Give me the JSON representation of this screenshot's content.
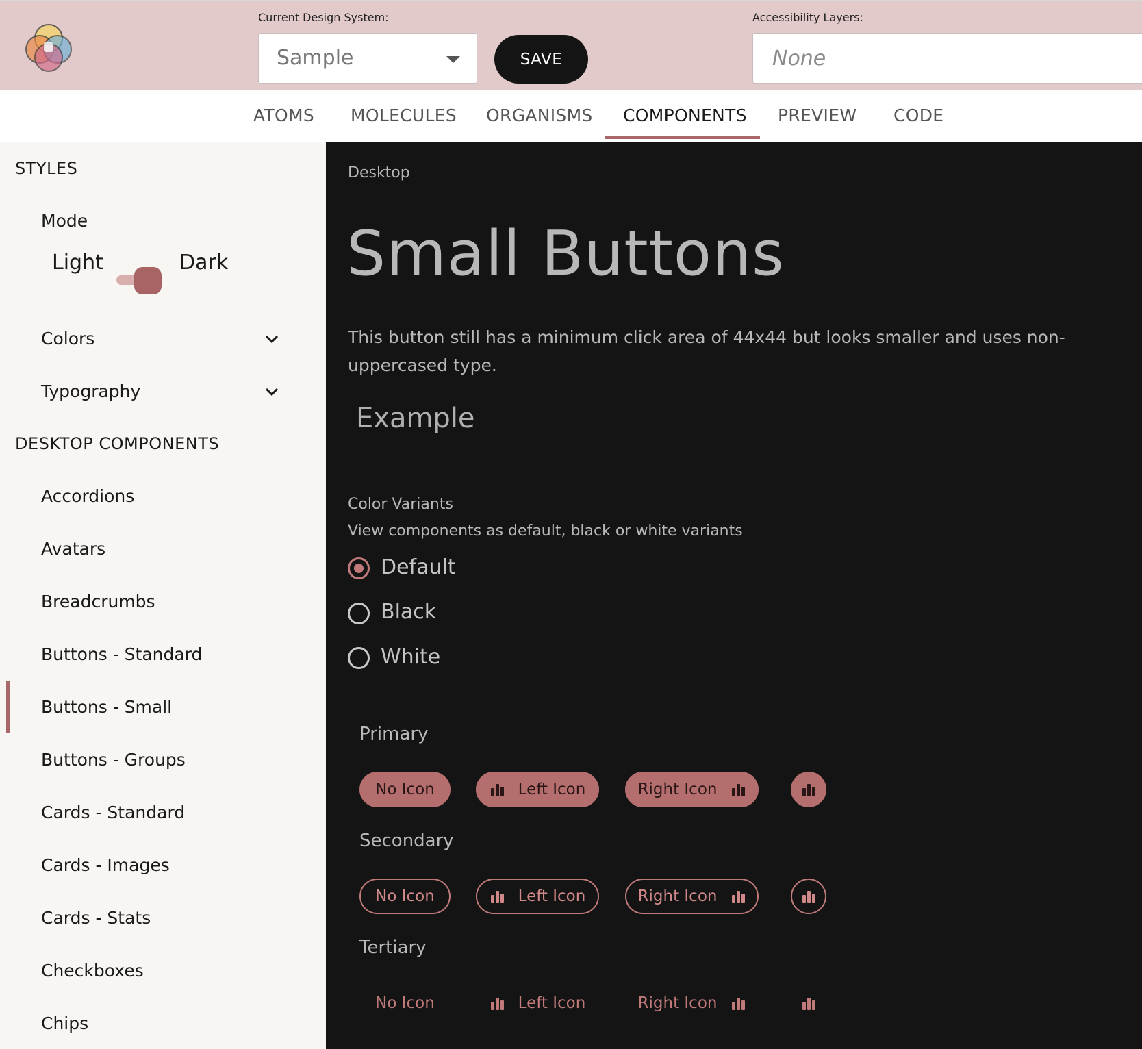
{
  "header": {
    "design_system_label": "Current Design System:",
    "design_system_value": "Sample",
    "save_label": "SAVE",
    "accessibility_label": "Accessibility Layers:",
    "accessibility_placeholder": "None"
  },
  "tabs": [
    {
      "label": "ATOMS",
      "active": false
    },
    {
      "label": "MOLECULES",
      "active": false
    },
    {
      "label": "ORGANISMS",
      "active": false
    },
    {
      "label": "COMPONENTS",
      "active": true
    },
    {
      "label": "PREVIEW",
      "active": false
    },
    {
      "label": "CODE",
      "active": false
    }
  ],
  "sidebar": {
    "styles_heading": "STYLES",
    "mode_label": "Mode",
    "mode_light": "Light",
    "mode_dark": "Dark",
    "mode_value": "Dark",
    "colors_label": "Colors",
    "typography_label": "Typography",
    "components_heading": "DESKTOP COMPONENTS",
    "items": [
      {
        "label": "Accordions"
      },
      {
        "label": "Avatars"
      },
      {
        "label": "Breadcrumbs"
      },
      {
        "label": "Buttons - Standard"
      },
      {
        "label": "Buttons - Small",
        "active": true
      },
      {
        "label": "Buttons - Groups"
      },
      {
        "label": "Cards - Standard"
      },
      {
        "label": "Cards - Images"
      },
      {
        "label": "Cards - Stats"
      },
      {
        "label": "Checkboxes"
      },
      {
        "label": "Chips"
      }
    ]
  },
  "main": {
    "breadcrumb": "Desktop",
    "title": "Small Buttons",
    "description": "This button still has a minimum click area of 44x44 but looks smaller and uses non-uppercased type.",
    "example_heading": "Example",
    "color_variants_title": "Color Variants",
    "color_variants_subtitle": "View components as default, black or white variants",
    "variants": [
      {
        "label": "Default",
        "checked": true
      },
      {
        "label": "Black",
        "checked": false
      },
      {
        "label": "White",
        "checked": false
      }
    ],
    "groups": [
      {
        "label": "Primary",
        "buttons": [
          "No Icon",
          "Left Icon",
          "Right Icon"
        ]
      },
      {
        "label": "Secondary",
        "buttons": [
          "No Icon",
          "Left Icon",
          "Right Icon"
        ]
      },
      {
        "label": "Tertiary",
        "buttons": [
          "No Icon",
          "Left Icon",
          "Right Icon"
        ]
      }
    ]
  },
  "colors": {
    "accent": "#a86868",
    "header_bg": "#e2caca",
    "primary_button": "#b56e6e",
    "content_bg": "#141414",
    "sidebar_bg": "#f8f6f3"
  },
  "icons": {
    "logo": "overlapping-circles-logo",
    "caret": "triangle-down-icon",
    "chevron": "chevron-down-icon",
    "button_icon": "bar-chart-icon"
  }
}
